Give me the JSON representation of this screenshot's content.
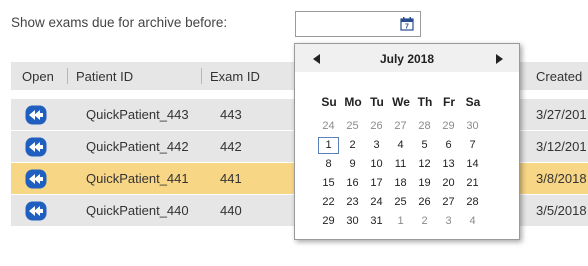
{
  "filter": {
    "label": "Show exams due for archive before:",
    "date_value": "",
    "calendar_icon": "calendar-icon"
  },
  "table": {
    "columns": [
      "Open",
      "Patient ID",
      "Exam ID",
      "Created"
    ],
    "rows": [
      {
        "patient_id": "QuickPatient_443",
        "exam_id": "443",
        "created": "3/27/201",
        "selected": false
      },
      {
        "patient_id": "QuickPatient_442",
        "exam_id": "442",
        "created": "3/12/201",
        "selected": false
      },
      {
        "patient_id": "QuickPatient_441",
        "exam_id": "441",
        "created": "3/8/2018",
        "selected": true
      },
      {
        "patient_id": "QuickPatient_440",
        "exam_id": "440",
        "created": "3/5/2018",
        "selected": false
      }
    ],
    "open_icon": "back-arrow-icon"
  },
  "calendar": {
    "month_label": "July 2018",
    "weekdays": [
      "Su",
      "Mo",
      "Tu",
      "We",
      "Th",
      "Fr",
      "Sa"
    ],
    "weeks": [
      [
        "24",
        "25",
        "26",
        "27",
        "28",
        "29",
        "30"
      ],
      [
        "1",
        "2",
        "3",
        "4",
        "5",
        "6",
        "7"
      ],
      [
        "8",
        "9",
        "10",
        "11",
        "12",
        "13",
        "14"
      ],
      [
        "15",
        "16",
        "17",
        "18",
        "19",
        "20",
        "21"
      ],
      [
        "22",
        "23",
        "24",
        "25",
        "26",
        "27",
        "28"
      ],
      [
        "29",
        "30",
        "31",
        "1",
        "2",
        "3",
        "4"
      ]
    ],
    "other_month_weeks": [
      [
        true,
        true,
        true,
        true,
        true,
        true,
        true
      ],
      [
        false,
        false,
        false,
        false,
        false,
        false,
        false
      ],
      [
        false,
        false,
        false,
        false,
        false,
        false,
        false
      ],
      [
        false,
        false,
        false,
        false,
        false,
        false,
        false
      ],
      [
        false,
        false,
        false,
        false,
        false,
        false,
        false
      ],
      [
        false,
        false,
        false,
        true,
        true,
        true,
        true
      ]
    ],
    "today": "1",
    "prev_icon": "triangle-left-icon",
    "next_icon": "triangle-right-icon"
  },
  "colors": {
    "row_background": "#e6e6e6",
    "selected_row": "#f7d686",
    "open_icon_blue": "#1f5fbf",
    "today_border": "#5b7fb8"
  }
}
